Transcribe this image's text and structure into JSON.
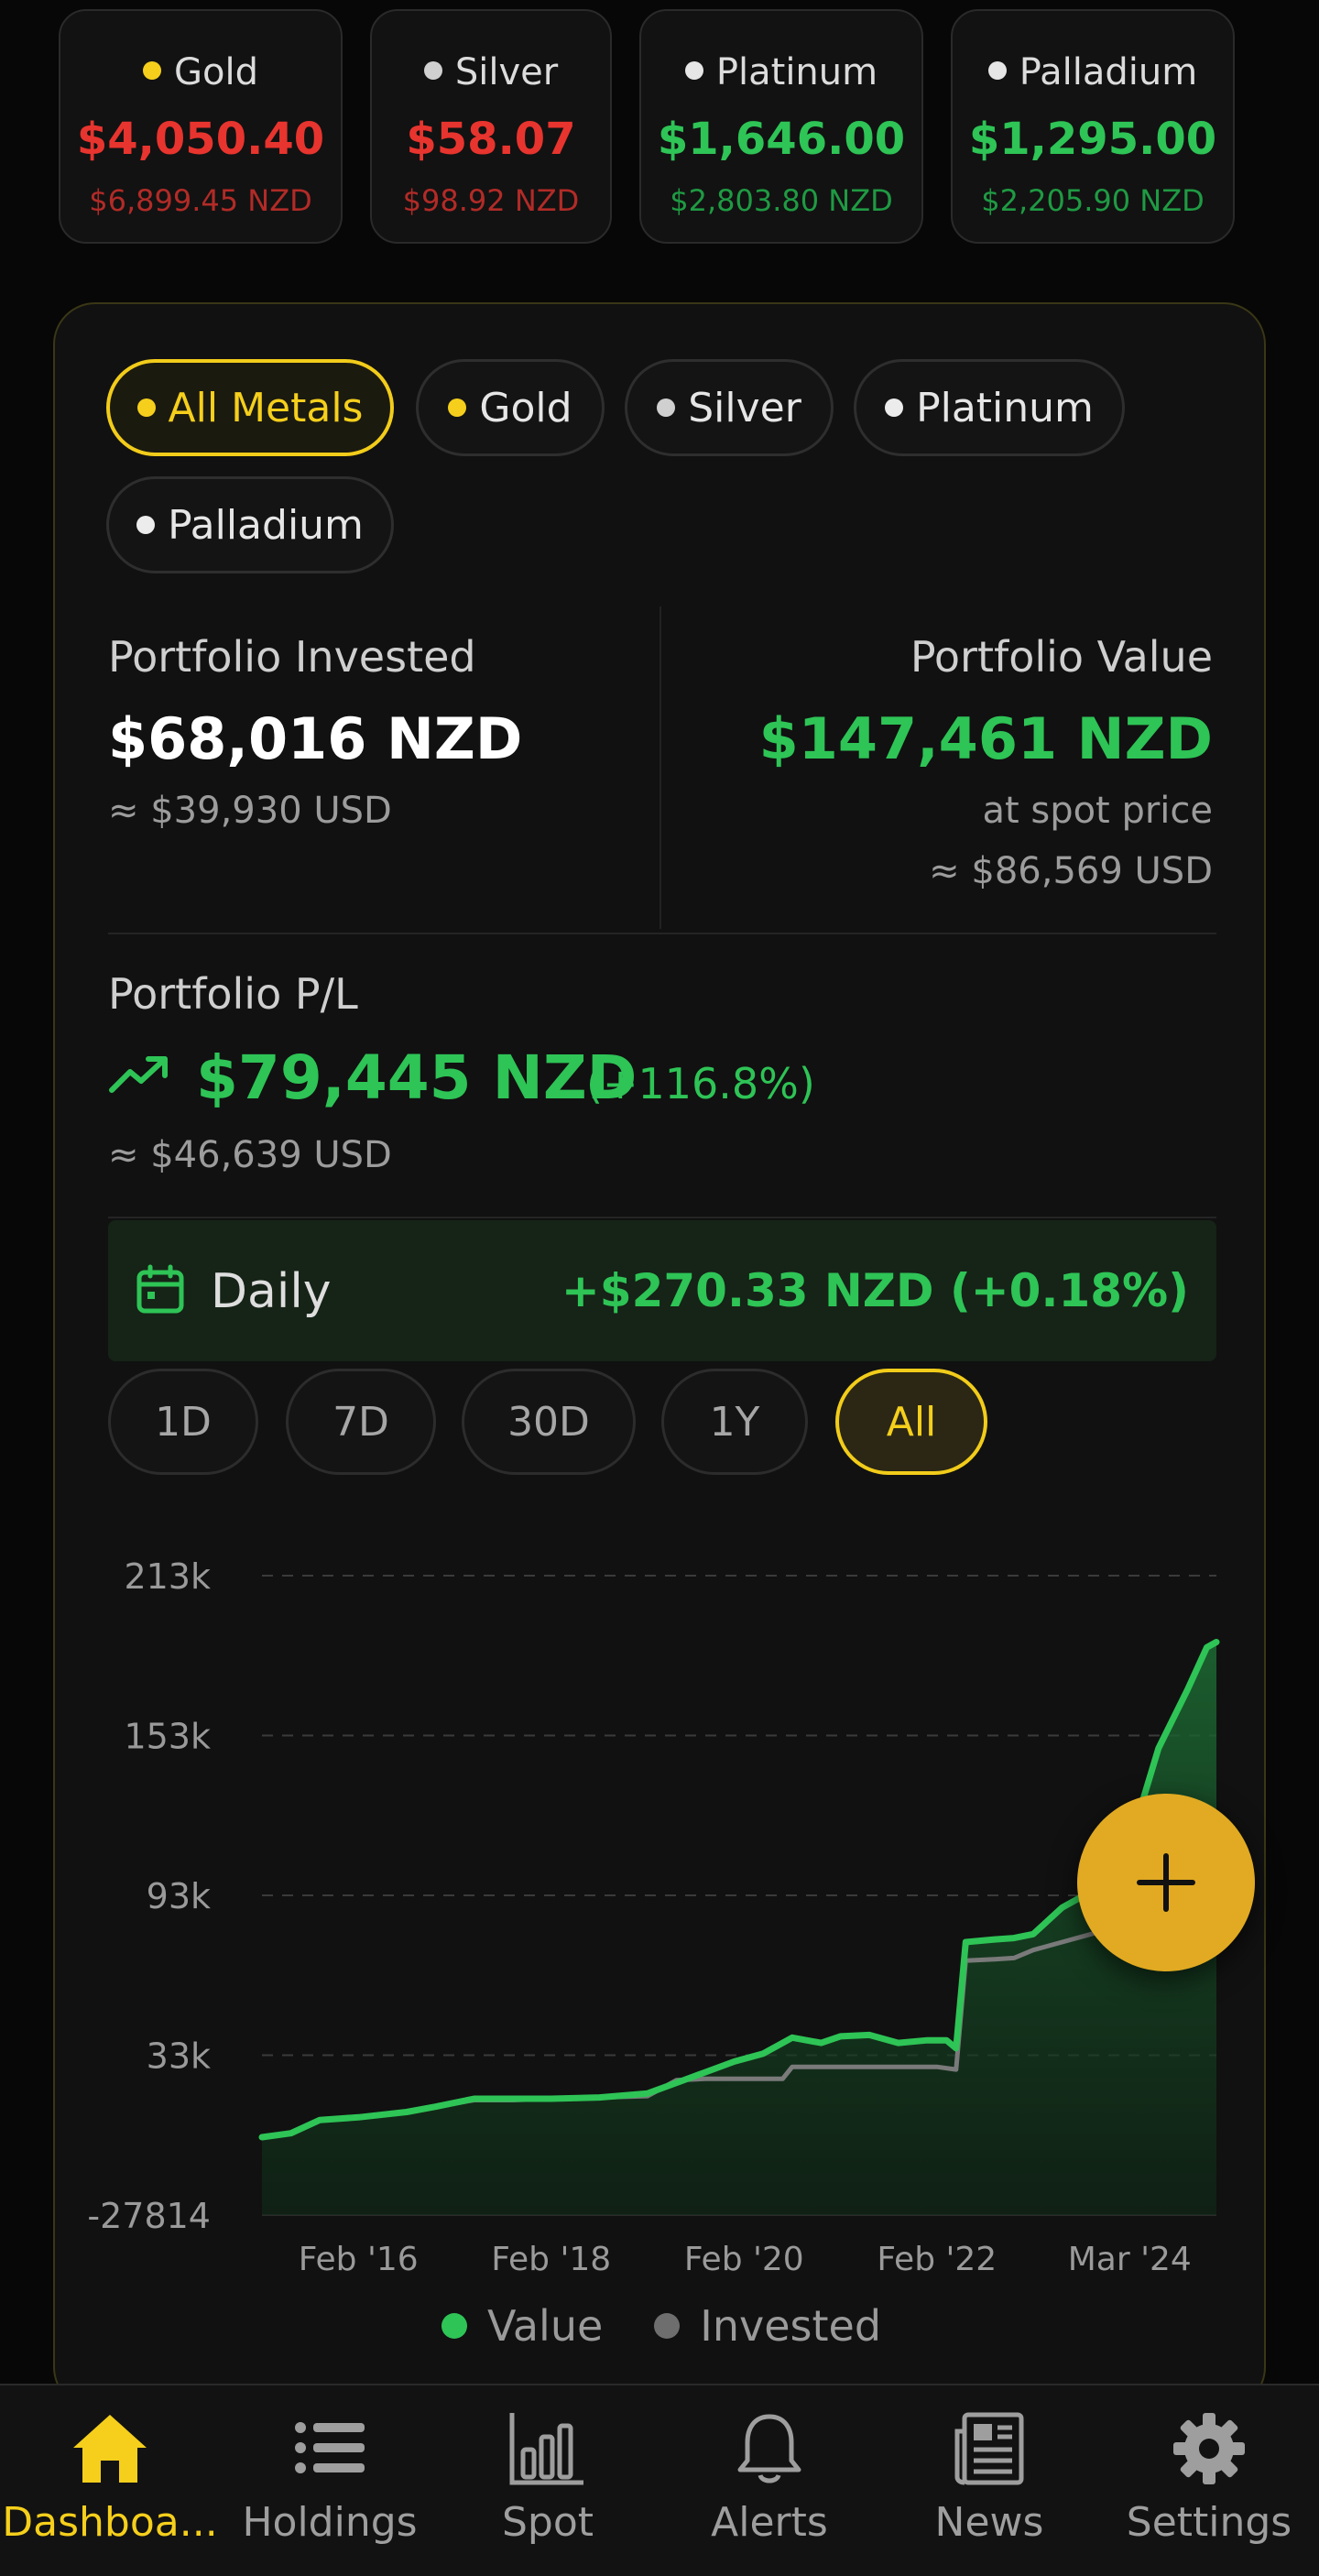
{
  "metals": [
    {
      "name": "Gold",
      "price": "$4,050.40",
      "nzd": "$6,899.45 NZD",
      "dot": "#f5cf1c",
      "trend": "down"
    },
    {
      "name": "Silver",
      "price": "$58.07",
      "nzd": "$98.92 NZD",
      "dot": "#d0d0d0",
      "trend": "down"
    },
    {
      "name": "Platinum",
      "price": "$1,646.00",
      "nzd": "$2,803.80 NZD",
      "dot": "#e6e6e6",
      "trend": "up"
    },
    {
      "name": "Palladium",
      "price": "$1,295.00",
      "nzd": "$2,205.90 NZD",
      "dot": "#e6e6e6",
      "trend": "up"
    }
  ],
  "filters": [
    "All Metals",
    "Gold",
    "Silver",
    "Platinum",
    "Palladium"
  ],
  "active_filter": "All Metals",
  "invested": {
    "label": "Portfolio Invested",
    "value": "$68,016 NZD",
    "usd": "≈ $39,930 USD"
  },
  "value": {
    "label": "Portfolio Value",
    "value": "$147,461 NZD",
    "note": "at spot price",
    "usd": "≈ $86,569 USD"
  },
  "pl": {
    "label": "Portfolio P/L",
    "value": "$79,445 NZD",
    "pct": "(+116.8%)",
    "usd": "≈ $46,639 USD"
  },
  "daily": {
    "label": "Daily",
    "value": "+$270.33 NZD  (+0.18%)"
  },
  "ranges": [
    "1D",
    "7D",
    "30D",
    "1Y",
    "All"
  ],
  "active_range": "All",
  "chart_data": {
    "type": "area",
    "y_ticks": [
      "213k",
      "153k",
      "93k",
      "33k",
      "-27814"
    ],
    "ylim": [
      -27814,
      213000
    ],
    "x_ticks": [
      "Feb '16",
      "Feb '18",
      "Feb '20",
      "Feb '22",
      "Mar '24"
    ],
    "series": [
      {
        "name": "Value",
        "color": "#2ec456",
        "points": [
          [
            2015.0,
            1500
          ],
          [
            2015.3,
            3000
          ],
          [
            2015.6,
            8000
          ],
          [
            2016.0,
            9000
          ],
          [
            2016.5,
            11000
          ],
          [
            2016.8,
            13000
          ],
          [
            2017.2,
            16000
          ],
          [
            2017.6,
            16000
          ],
          [
            2018.0,
            16000
          ],
          [
            2018.5,
            16500
          ],
          [
            2019.0,
            18000
          ],
          [
            2019.3,
            22000
          ],
          [
            2019.6,
            26000
          ],
          [
            2019.9,
            30000
          ],
          [
            2020.2,
            33000
          ],
          [
            2020.5,
            39000
          ],
          [
            2020.8,
            37000
          ],
          [
            2021.0,
            39500
          ],
          [
            2021.3,
            40000
          ],
          [
            2021.6,
            37000
          ],
          [
            2021.9,
            38000
          ],
          [
            2022.1,
            38000
          ],
          [
            2022.2,
            35000
          ],
          [
            2022.3,
            75000
          ],
          [
            2022.6,
            76000
          ],
          [
            2022.8,
            76500
          ],
          [
            2023.0,
            78000
          ],
          [
            2023.3,
            88000
          ],
          [
            2023.5,
            92000
          ],
          [
            2023.8,
            103000
          ],
          [
            2024.0,
            112000
          ],
          [
            2024.3,
            148000
          ],
          [
            2024.6,
            170000
          ],
          [
            2024.8,
            186000
          ],
          [
            2024.9,
            188000
          ]
        ]
      },
      {
        "name": "Invested",
        "color": "#7a7a7a",
        "points": [
          [
            2015.0,
            1500
          ],
          [
            2015.3,
            3000
          ],
          [
            2015.6,
            8000
          ],
          [
            2016.0,
            9000
          ],
          [
            2016.5,
            11000
          ],
          [
            2016.8,
            13000
          ],
          [
            2017.2,
            15500
          ],
          [
            2017.6,
            15500
          ],
          [
            2018.0,
            16000
          ],
          [
            2018.5,
            16500
          ],
          [
            2019.0,
            17000
          ],
          [
            2019.3,
            23000
          ],
          [
            2019.6,
            23500
          ],
          [
            2020.0,
            23500
          ],
          [
            2020.4,
            23500
          ],
          [
            2020.5,
            28000
          ],
          [
            2021.0,
            28000
          ],
          [
            2021.5,
            28000
          ],
          [
            2022.0,
            28000
          ],
          [
            2022.2,
            27000
          ],
          [
            2022.3,
            68000
          ],
          [
            2022.6,
            68500
          ],
          [
            2022.8,
            69000
          ],
          [
            2023.0,
            72000
          ],
          [
            2023.3,
            75000
          ],
          [
            2023.6,
            78000
          ],
          [
            2023.8,
            80000
          ]
        ]
      }
    ],
    "legend": [
      "Value",
      "Invested"
    ],
    "grid": true
  },
  "nav": [
    {
      "label": "Dashboa...",
      "icon": "home-icon",
      "active": true
    },
    {
      "label": "Holdings",
      "icon": "list-icon",
      "active": false
    },
    {
      "label": "Spot",
      "icon": "bar-chart-icon",
      "active": false
    },
    {
      "label": "Alerts",
      "icon": "bell-icon",
      "active": false
    },
    {
      "label": "News",
      "icon": "news-icon",
      "active": false
    },
    {
      "label": "Settings",
      "icon": "gear-icon",
      "active": false
    }
  ]
}
